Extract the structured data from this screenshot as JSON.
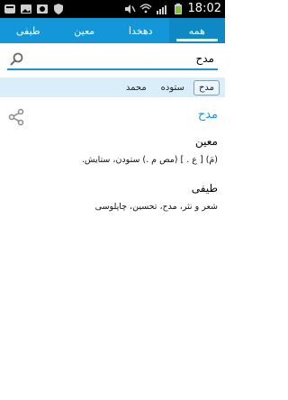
{
  "statusbar": {
    "time": "18:02",
    "icons_left": [
      "notification-icon",
      "gallery-icon",
      "image-icon",
      "shield-icon"
    ],
    "icons_right": [
      "mute-icon",
      "wifi-icon",
      "signal-icon",
      "battery-icon"
    ]
  },
  "tabs": [
    {
      "label": "همه",
      "active": true
    },
    {
      "label": "دهخدا",
      "active": false
    },
    {
      "label": "معین",
      "active": false
    },
    {
      "label": "طیفی",
      "active": false
    }
  ],
  "search": {
    "value": "مدح"
  },
  "chips": [
    {
      "label": "مدح",
      "active": true
    },
    {
      "label": "ستوده",
      "active": false
    },
    {
      "label": "محمد",
      "active": false
    }
  ],
  "result": {
    "headword": "مدح",
    "sections": [
      {
        "title": "معین",
        "text": "(مَ) [ ع . ] (مص م .) ستودن، ستایش."
      },
      {
        "title": "طیفی",
        "text": "شعر و نثر، مدح، تحسین، چاپلوسی"
      }
    ]
  },
  "colors": {
    "accent": "#1497d8",
    "chipbar": "#d9eef8"
  }
}
